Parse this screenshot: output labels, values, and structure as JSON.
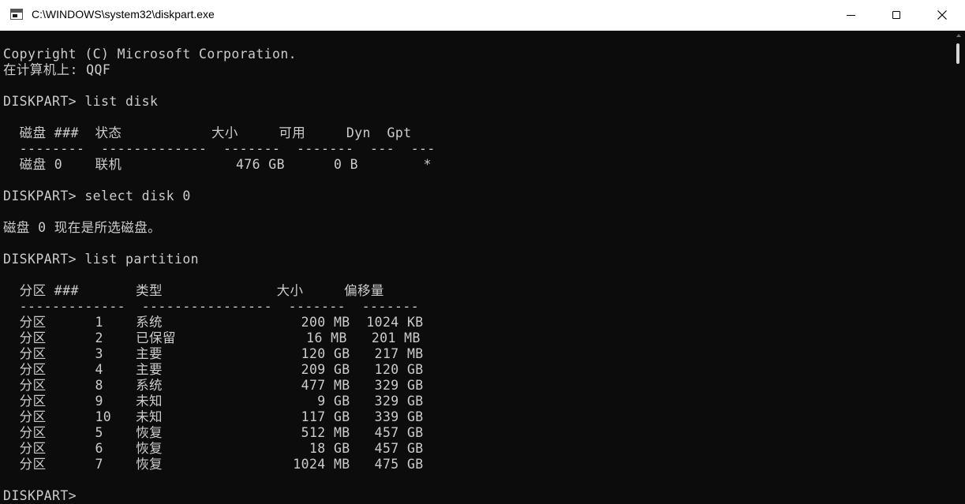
{
  "window": {
    "title": "C:\\WINDOWS\\system32\\diskpart.exe",
    "icons": {
      "app": "console-app-icon",
      "minimize": "minimize-icon",
      "maximize": "maximize-icon",
      "close": "close-icon"
    }
  },
  "console": {
    "lines": [
      "Copyright (C) Microsoft Corporation.",
      "在计算机上: QQF",
      "",
      "DISKPART> list disk",
      "",
      "  磁盘 ###  状态           大小     可用     Dyn  Gpt",
      "  --------  -------------  -------  -------  ---  ---",
      "  磁盘 0    联机              476 GB      0 B        *",
      "",
      "DISKPART> select disk 0",
      "",
      "磁盘 0 现在是所选磁盘。",
      "",
      "DISKPART> list partition",
      "",
      "  分区 ###       类型              大小     偏移量",
      "  -------------  ----------------  -------  -------",
      "  分区      1    系统                 200 MB  1024 KB",
      "  分区      2    已保留                16 MB   201 MB",
      "  分区      3    主要                 120 GB   217 MB",
      "  分区      4    主要                 209 GB   120 GB",
      "  分区      8    系统                 477 MB   329 GB",
      "  分区      9    未知                   9 GB   329 GB",
      "  分区      10   未知                 117 GB   339 GB",
      "  分区      5    恢复                 512 MB   457 GB",
      "  分区      6    恢复                  18 GB   457 GB",
      "  分区      7    恢复                1024 MB   475 GB",
      "",
      "DISKPART>"
    ]
  },
  "colors": {
    "console_bg": "#0c0c0c",
    "console_fg": "#cccccc",
    "titlebar_bg": "#ffffff"
  }
}
